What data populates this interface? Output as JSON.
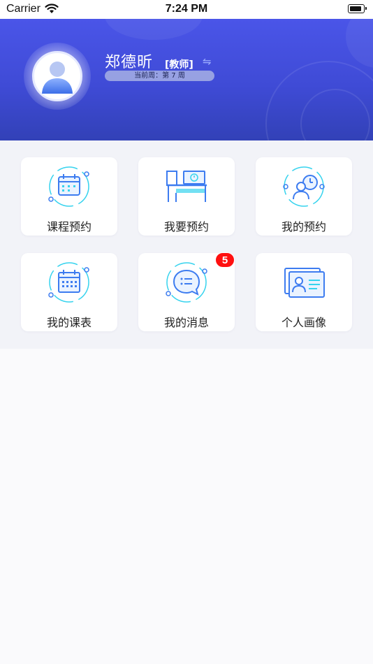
{
  "status_bar": {
    "carrier": "Carrier",
    "time": "7:24 PM"
  },
  "profile": {
    "name": "郑德昕",
    "role": "[教师]",
    "week": "当前周：第 7 周"
  },
  "menu": [
    {
      "label": "课程预约",
      "icon": "calendar-icon"
    },
    {
      "label": "我要预约",
      "icon": "desk-icon"
    },
    {
      "label": "我的预约",
      "icon": "user-clock-icon"
    },
    {
      "label": "我的课表",
      "icon": "timetable-icon"
    },
    {
      "label": "我的消息",
      "icon": "message-icon",
      "badge": "5"
    },
    {
      "label": "个人画像",
      "icon": "id-card-icon"
    }
  ],
  "colors": {
    "banner_top": "#4a55e8",
    "banner_bottom": "#3241b7",
    "icon_blue": "#3d7cf0",
    "icon_cyan": "#36d3ee",
    "badge_red": "#ff1010"
  }
}
